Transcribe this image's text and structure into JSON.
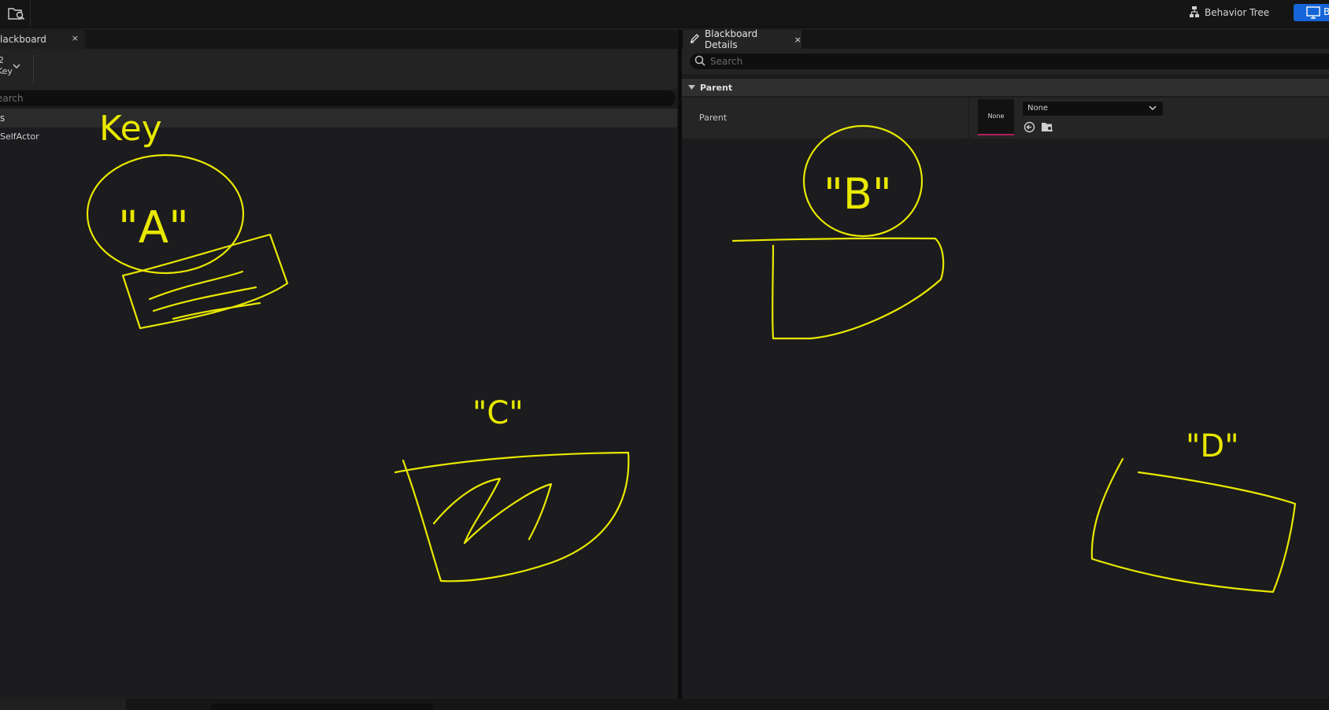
{
  "toolbar": {
    "behavior_tree_label": "Behavior Tree",
    "blackboard_mode_label": "B"
  },
  "left_panel": {
    "tab_label": "lackboard",
    "tab_close": "×",
    "new_key_line1": "2",
    "new_key_line2": "Key",
    "search_placeholder": "earch",
    "group_label": "s",
    "keys": [
      "SelfActor"
    ]
  },
  "right_panel": {
    "tab_label": "Blackboard Details",
    "tab_close": "×",
    "search_placeholder": "Search",
    "section_label": "Parent",
    "property": {
      "label": "Parent",
      "thumbnail_text": "None",
      "combo_value": "None"
    }
  },
  "annotations": {
    "key": "Key",
    "a": "\"A\"",
    "b": "\"B\"",
    "c": "\"C\"",
    "d": "\"D\""
  },
  "colors": {
    "annotation": "#e8e800",
    "accent_blue": "#1565d8",
    "thumbnail_underline": "#b0205a"
  },
  "icons": {
    "top_left": "folder-search-icon",
    "behavior_tree": "behavior-tree-icon",
    "blackboard_mode": "monitor-icon",
    "details_tab": "pencil-icon",
    "search": "search-icon",
    "section_toggle": "triangle-down-icon",
    "use_selected": "arrow-left-circle-icon",
    "browse": "folder-search-icon"
  }
}
